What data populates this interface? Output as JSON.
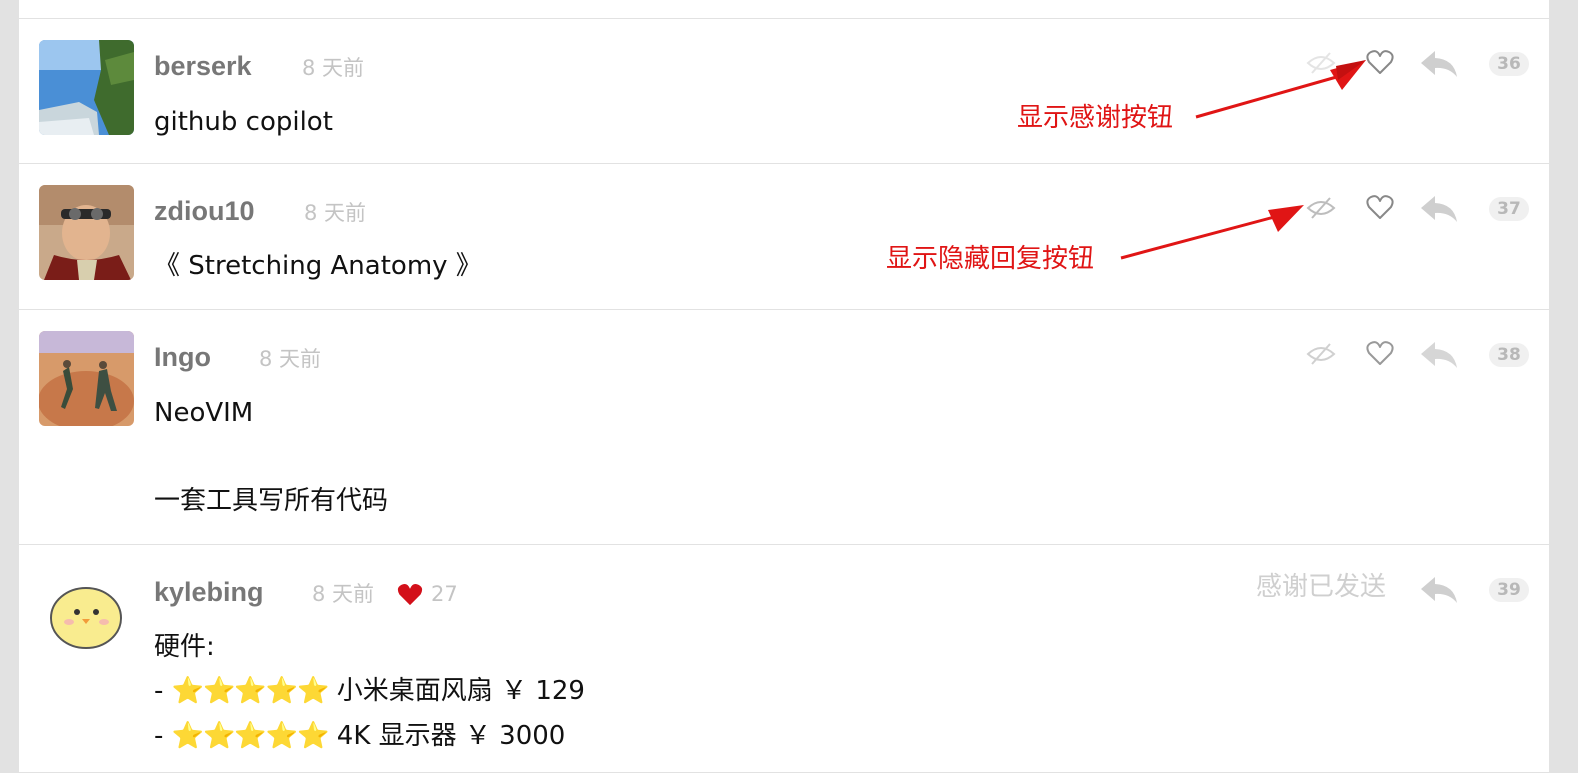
{
  "replies": [
    {
      "username": "berserk",
      "time_ago": "8 天前",
      "content": "github copilot",
      "reply_number": "36",
      "avatar": "coastal-cliff-photo"
    },
    {
      "username": "zdiou10",
      "time_ago": "8 天前",
      "content": "《 Stretching Anatomy 》",
      "reply_number": "37",
      "avatar": "man-with-goggles-photo"
    },
    {
      "username": "Ingo",
      "time_ago": "8 天前",
      "content_lines": [
        "NeoVIM",
        "一套工具写所有代码"
      ],
      "reply_number": "38",
      "avatar": "desert-figures-photo"
    },
    {
      "username": "kylebing",
      "time_ago": "8 天前",
      "thanks_count": "27",
      "thanks_sent_label": "感谢已发送",
      "reply_number": "39",
      "avatar": "yellow-chick-illustration",
      "content_lines": [
        {
          "text": "硬件:"
        },
        {
          "prefix": "- ",
          "stars": "⭐⭐⭐⭐⭐",
          "text": " 小米桌面风扇 ￥ 129"
        },
        {
          "prefix": "- ",
          "stars": "⭐⭐⭐⭐⭐",
          "text": " 4K 显示器 ￥ 3000"
        }
      ]
    }
  ],
  "annotations": {
    "thanks_button": "显示感谢按钮",
    "hide_reply_button": "显示隐藏回复按钮"
  },
  "colors": {
    "annotation": "#e01515",
    "heart_filled": "#d3101a",
    "icon": "#999999",
    "background": "#e2e2e2"
  },
  "icons": [
    "hide-icon",
    "heart-outline-icon",
    "reply-arrow-icon",
    "heart-filled-icon"
  ]
}
